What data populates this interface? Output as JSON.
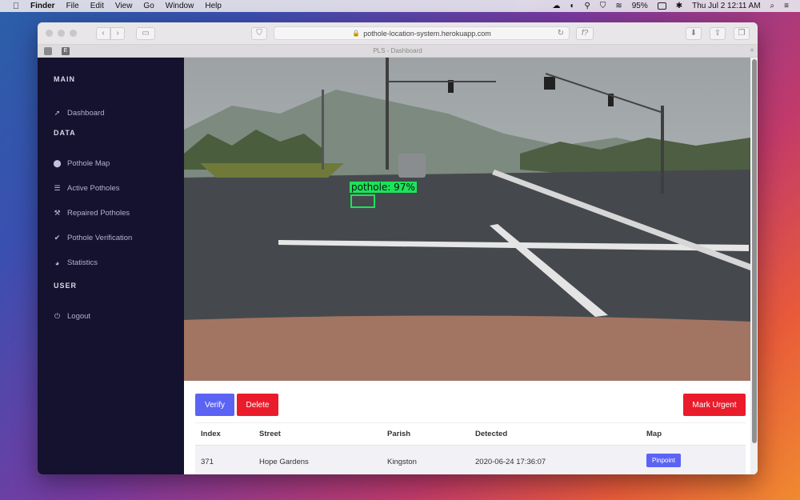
{
  "menubar": {
    "app": "Finder",
    "items": [
      "File",
      "Edit",
      "View",
      "Go",
      "Window",
      "Help"
    ],
    "battery": "95%",
    "datetime": "Thu Jul 2  12:11 AM"
  },
  "browser": {
    "url": "pothole-location-system.herokuapp.com",
    "tab_title": "PLS - Dashboard",
    "fx_label": "f?"
  },
  "sidebar": {
    "main_heading": "MAIN",
    "data_heading": "DATA",
    "user_heading": "USER",
    "items": {
      "dashboard": "Dashboard",
      "pothole_map": "Pothole Map",
      "active_potholes": "Active Potholes",
      "repaired_potholes": "Repaired Potholes",
      "pothole_verification": "Pothole Verification",
      "statistics": "Statistics",
      "logout": "Logout"
    }
  },
  "detection": {
    "label": "pothole: 97%",
    "color": "#1be35a"
  },
  "actions": {
    "verify": "Verify",
    "delete": "Delete",
    "mark_urgent": "Mark Urgent"
  },
  "table": {
    "headers": [
      "Index",
      "Street",
      "Parish",
      "Detected",
      "Map"
    ],
    "rows": [
      {
        "index": "371",
        "street": "Hope Gardens",
        "parish": "Kingston",
        "detected": "2020-06-24 17:36:07",
        "map": "Pinpoint"
      }
    ]
  },
  "colors": {
    "sidebar_bg": "#14122e",
    "primary": "#5b63f5",
    "danger": "#ea1c2c"
  }
}
